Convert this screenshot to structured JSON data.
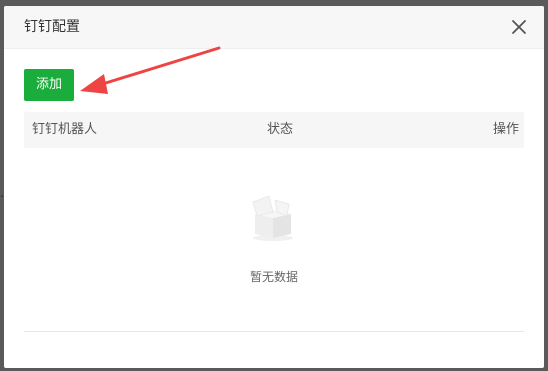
{
  "dialog": {
    "title": "钉钉配置",
    "close_icon": "close-icon"
  },
  "toolbar": {
    "add_label": "添加"
  },
  "table": {
    "columns": [
      "钉钉机器人",
      "状态",
      "操作"
    ],
    "rows": [],
    "empty_text": "暂无数据",
    "empty_icon": "empty-box-icon"
  },
  "annotation": {
    "arrow_color": "#ee4444"
  },
  "colors": {
    "accent": "#1aad3b",
    "header_bg": "#f7f7f7",
    "table_header_bg": "#f6f6f6"
  }
}
